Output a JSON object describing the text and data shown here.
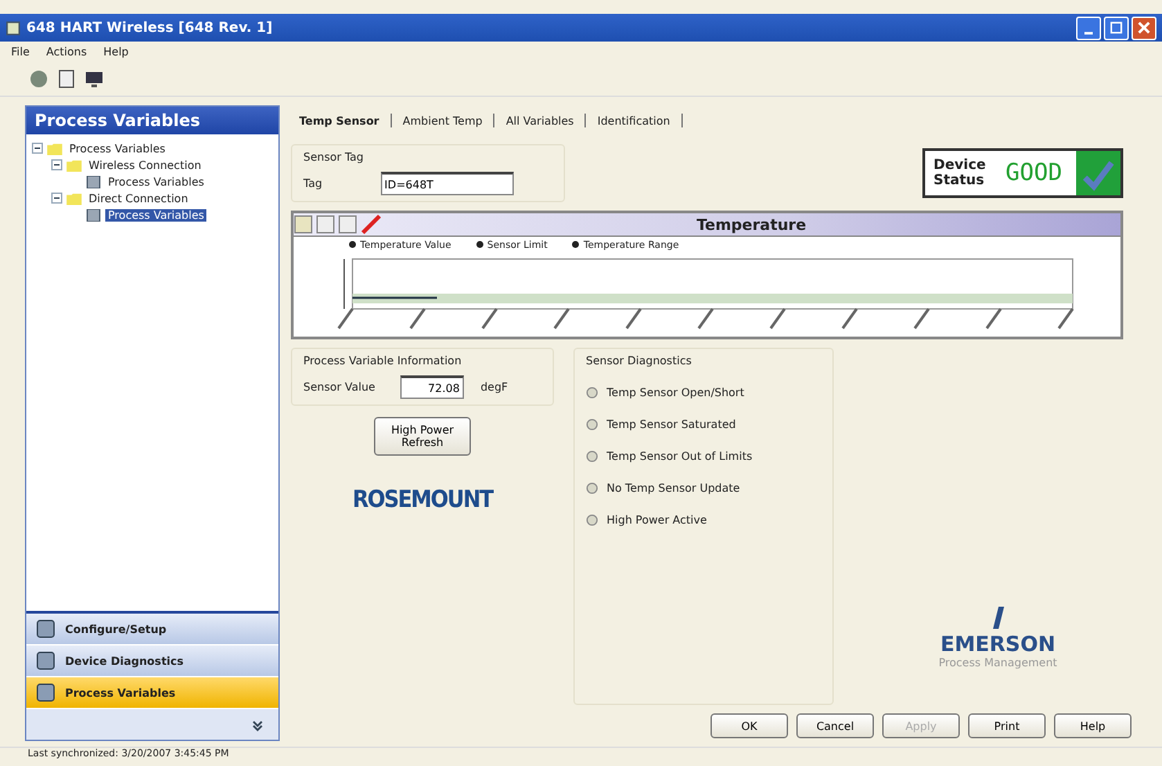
{
  "window": {
    "title": "648 HART Wireless [648 Rev. 1]"
  },
  "menu": [
    "File",
    "Actions",
    "Help"
  ],
  "sidebar": {
    "title": "Process Variables",
    "tree": [
      {
        "label": "Process Variables",
        "kind": "folder",
        "expanded": true,
        "selected": false,
        "children": [
          {
            "label": "Wireless Connection",
            "kind": "folder",
            "expanded": true,
            "selected": false,
            "children": [
              {
                "label": "Process Variables",
                "kind": "page",
                "selected": false
              }
            ]
          },
          {
            "label": "Direct Connection",
            "kind": "folder",
            "expanded": true,
            "selected": false,
            "children": [
              {
                "label": "Process Variables",
                "kind": "page",
                "selected": true
              }
            ]
          }
        ]
      }
    ],
    "nav": [
      {
        "label": "Configure/Setup",
        "selected": false
      },
      {
        "label": "Device Diagnostics",
        "selected": false
      },
      {
        "label": "Process Variables",
        "selected": true
      }
    ]
  },
  "tabs": [
    {
      "label": "Temp Sensor",
      "selected": true
    },
    {
      "label": "Ambient Temp",
      "selected": false
    },
    {
      "label": "All Variables",
      "selected": false
    },
    {
      "label": "Identification",
      "selected": false
    }
  ],
  "sensor_tag": {
    "title": "Sensor Tag",
    "label": "Tag",
    "value": "ID=648T"
  },
  "device_status": {
    "label": "Device Status",
    "value": "GOOD"
  },
  "chart": {
    "title": "Temperature",
    "legend": [
      "Temperature Value",
      "Sensor Limit",
      "Temperature Range"
    ]
  },
  "pv_info": {
    "title": "Process Variable Information",
    "label": "Sensor Value",
    "value": "72.08",
    "unit": "degF",
    "button": "High Power Refresh"
  },
  "diagnostics": {
    "title": "Sensor Diagnostics",
    "items": [
      {
        "label": "Temp Sensor Open/Short",
        "on": false
      },
      {
        "label": "Temp Sensor Saturated",
        "on": false
      },
      {
        "label": "Temp Sensor Out of Limits",
        "on": false
      },
      {
        "label": "No Temp Sensor Update",
        "on": false
      },
      {
        "label": "High Power Active",
        "on": false
      }
    ]
  },
  "logos": {
    "left": "ROSEMOUNT",
    "right": "EMERSON",
    "right_sub": "Process Management"
  },
  "buttons": [
    {
      "label": "OK",
      "disabled": false
    },
    {
      "label": "Cancel",
      "disabled": false
    },
    {
      "label": "Apply",
      "disabled": true
    },
    {
      "label": "Print",
      "disabled": false
    },
    {
      "label": "Help",
      "disabled": false
    }
  ],
  "status_bar": "Last synchronized: 3/20/2007 3:45:45 PM"
}
